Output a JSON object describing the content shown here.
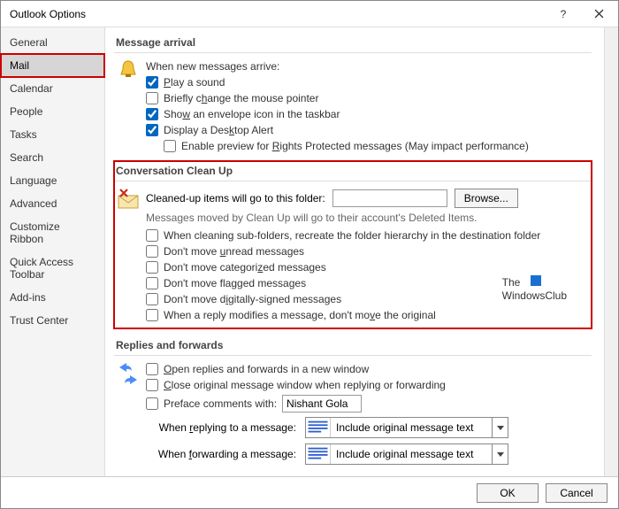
{
  "window": {
    "title": "Outlook Options"
  },
  "sidebar": {
    "items": [
      {
        "label": "General"
      },
      {
        "label": "Mail"
      },
      {
        "label": "Calendar"
      },
      {
        "label": "People"
      },
      {
        "label": "Tasks"
      },
      {
        "label": "Search"
      },
      {
        "label": "Language"
      },
      {
        "label": "Advanced"
      },
      {
        "label": "Customize Ribbon"
      },
      {
        "label": "Quick Access Toolbar"
      },
      {
        "label": "Add-ins"
      },
      {
        "label": "Trust Center"
      }
    ],
    "selected": 1
  },
  "arrival": {
    "header": "Message arrival",
    "intro": "When new messages arrive:",
    "play_sound": "Play a sound",
    "change_pointer": "Briefly change the mouse pointer",
    "envelope_icon": "Show an envelope icon in the taskbar",
    "desktop_alert": "Display a Desktop Alert",
    "rights_preview": "Enable preview for Rights Protected messages (May impact performance)"
  },
  "cleanup": {
    "header": "Conversation Clean Up",
    "folder_label": "Cleaned-up items will go to this folder:",
    "folder_value": "",
    "browse": "Browse...",
    "help": "Messages moved by Clean Up will go to their account's Deleted Items.",
    "recreate_hierarchy": "When cleaning sub-folders, recreate the folder hierarchy in the destination folder",
    "dont_move_unread": "Don't move unread messages",
    "dont_move_categorized": "Don't move categorized messages",
    "dont_move_flagged": "Don't move flagged messages",
    "dont_move_signed": "Don't move digitally-signed messages",
    "reply_modifies": "When a reply modifies a message, don't move the original"
  },
  "replies": {
    "header": "Replies and forwards",
    "open_new_window": "Open replies and forwards in a new window",
    "close_original": "Close original message window when replying or forwarding",
    "preface_label": "Preface comments with:",
    "preface_value": "Nishant Gola",
    "when_replying_label": "When replying to a message:",
    "when_replying_value": "Include original message text",
    "when_forwarding_label": "When forwarding a message:",
    "when_forwarding_value": "Include original message text"
  },
  "watermark": {
    "line1": "The",
    "line2": "WindowsClub"
  },
  "footer": {
    "ok": "OK",
    "cancel": "Cancel"
  }
}
